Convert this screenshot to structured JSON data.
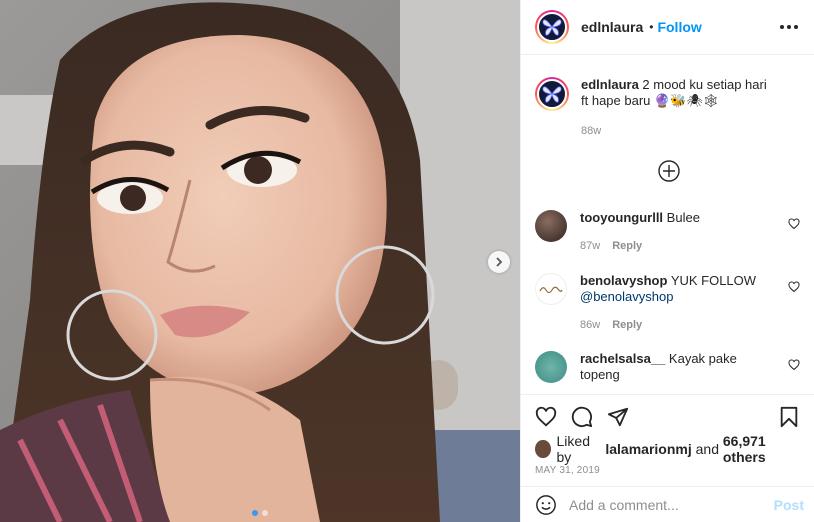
{
  "post": {
    "username": "edlnlaura",
    "separator": "•",
    "follow_label": "Follow",
    "more_icon": "more-options-icon"
  },
  "caption": {
    "username": "edlnlaura",
    "text": "2 mood ku setiap hari ft hape baru 🔮🐝🕷🕸",
    "time": "88w"
  },
  "comments": [
    {
      "username": "tooyoungurlll",
      "text": "Bulee",
      "mention": "",
      "time": "87w",
      "reply": "Reply"
    },
    {
      "username": "benolavyshop",
      "text": "YUK FOLLOW",
      "mention": "@benolavyshop",
      "time": "86w",
      "reply": "Reply"
    },
    {
      "username": "rachelsalsa__",
      "text": "Kayak pake topeng",
      "mention": "",
      "time": "",
      "reply": ""
    }
  ],
  "likes": {
    "prefix": "Liked by",
    "user": "lalamarionmj",
    "middle": "and",
    "count": "66,971 others"
  },
  "date": "MAY 31, 2019",
  "add_comment": {
    "placeholder": "Add a comment...",
    "post_label": "Post"
  },
  "colors": {
    "accent": "#0095f6",
    "post_disabled": "#b2dffc",
    "carousel_active": "#3897f0"
  },
  "carousel": {
    "total": 2,
    "active": 1
  }
}
